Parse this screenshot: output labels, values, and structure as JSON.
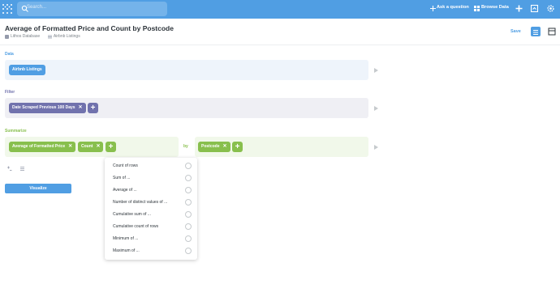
{
  "topbar": {
    "search_placeholder": "Search...",
    "ask_question": "Ask a question",
    "browse_data": "Browse Data",
    "icons": [
      "metabase-logo-icon",
      "search-icon",
      "plus-icon",
      "grid-icon",
      "new-icon",
      "snippet-icon",
      "gear-icon"
    ]
  },
  "header": {
    "title": "Average of Formatted Price and Count by Postcode",
    "database": "Lithos Database",
    "table": "Airbnb Listings",
    "save_label": "Save"
  },
  "sections": {
    "data": {
      "label": "Data",
      "chip": "Airbnb Listings",
      "color": "#509ee3"
    },
    "filter": {
      "label": "Filter",
      "chip": "Date Scraped Previous 100 Days",
      "color": "#7172ad"
    },
    "summarize": {
      "label": "Summarize",
      "color": "#88bf4d",
      "metrics": [
        "Average of Formatted Price",
        "Count"
      ],
      "by_label": "by",
      "breakout": "Postcode"
    }
  },
  "visualize_label": "Visualize",
  "aggregation_menu": [
    "Count of rows",
    "Sum of ...",
    "Average of ...",
    "Number of distinct values of ...",
    "Cumulative sum of ...",
    "Cumulative count of rows",
    "Minimum of ...",
    "Maximum of ..."
  ],
  "colors": {
    "brand": "#509ee3",
    "filter": "#7172ad",
    "summarize": "#88bf4d"
  }
}
